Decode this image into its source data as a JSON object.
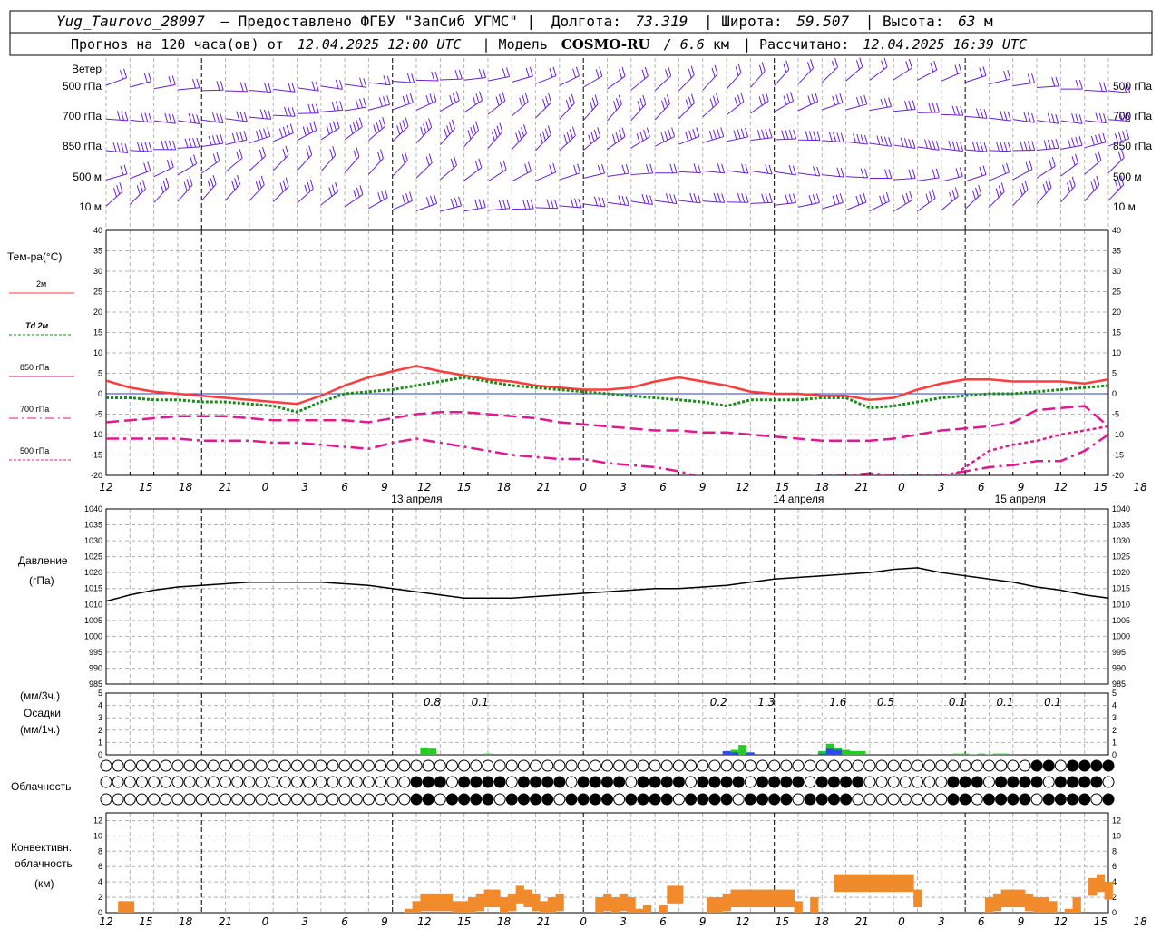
{
  "header": {
    "line1": {
      "station": "Yug_Taurovo_28097",
      "provider": "– Предоставлено ФГБУ \"ЗапСиб УГМС\" |",
      "lon_label": "Долгота:",
      "lon_value": "73.319",
      "lat_label": "| Широта:",
      "lat_value": "59.507",
      "alt_label": "| Высота:",
      "alt_value": "63",
      "alt_unit": "м"
    },
    "line2": {
      "forecast_label": "Прогноз на 120 часа(ов) от",
      "forecast_time": "12.04.2025 12:00 UTC",
      "model_label": "| Модель",
      "model_name": "COSMO-RU",
      "model_res": "/ 6.6",
      "model_res_unit": "км",
      "calc_label": "| Рассчитано:",
      "calc_time": "12.04.2025 16:39 UTC"
    }
  },
  "wind_panel": {
    "title": "Ветер",
    "levels": [
      "500 гПа",
      "700 гПа",
      "850 гПа",
      "500 м",
      "10 м"
    ],
    "color": "#6a1fd6"
  },
  "temp_panel": {
    "title": "Тем-ра(°C)",
    "legend": [
      {
        "label": "2м",
        "color": "#ff3b3b"
      },
      {
        "label": "Td  2м",
        "color": "#1a8a1a"
      },
      {
        "label": "850 гПа",
        "color": "#e0198c"
      },
      {
        "label": "700 гПа",
        "color": "#e0198c"
      },
      {
        "label": "500 гПа",
        "color": "#e0198c"
      }
    ]
  },
  "time_axis": {
    "hour_labels": [
      "12",
      "15",
      "18",
      "21",
      "0",
      "3",
      "6",
      "9",
      "12",
      "15",
      "18",
      "21",
      "0",
      "3",
      "6",
      "9",
      "12",
      "15",
      "18",
      "21",
      "0",
      "3",
      "6",
      "9",
      "12",
      "15",
      "18"
    ],
    "day_labels": [
      "13 апреля",
      "14 апреля",
      "15 апреля"
    ]
  },
  "pressure_panel": {
    "title": "Давление",
    "unit": "(гПа)",
    "ticks": [
      "1040",
      "1035",
      "1030",
      "1025",
      "1020",
      "1015",
      "1010",
      "1005",
      "1000",
      "995",
      "990",
      "985"
    ]
  },
  "precip_panel": {
    "unit3h": "(мм/3ч.)",
    "title": "Осадки",
    "unit1h": "(мм/1ч.)",
    "ticks": [
      "5",
      "4",
      "3",
      "2",
      "1",
      "0"
    ],
    "totals": [
      "0.8",
      "0.1",
      "0.2",
      "1.3",
      "1.6",
      "0.5",
      "0.1",
      "0.1",
      "0.1"
    ]
  },
  "cloud_panel": {
    "title": "Облачность"
  },
  "conv_panel": {
    "title1": "Конвективн.",
    "title2": "облачность",
    "unit": "(км)",
    "ticks": [
      "12",
      "10",
      "8",
      "6",
      "4",
      "2",
      "0"
    ],
    "color": "#f08a2a"
  },
  "temp_ticks": [
    "40",
    "35",
    "30",
    "25",
    "20",
    "15",
    "10",
    "5",
    "0",
    "-5",
    "-10",
    "-15",
    "-20"
  ],
  "chart_data": [
    {
      "type": "line",
      "title": "",
      "ylabel": "Тем-ра(°C)",
      "ylim": [
        -20,
        40
      ],
      "x_hours": [
        0,
        3,
        6,
        9,
        12,
        15,
        18,
        21,
        24,
        27,
        30,
        33,
        36,
        39,
        42,
        45,
        48,
        51,
        54,
        57,
        60,
        63,
        66,
        69,
        72,
        75,
        78,
        81,
        84,
        87,
        90,
        93,
        96,
        99,
        102,
        105,
        108,
        111,
        114,
        117,
        120,
        123,
        126
      ],
      "series": [
        {
          "name": "2м",
          "values": [
            3.2,
            1.5,
            0.5,
            0,
            -0.5,
            -1,
            -1.5,
            -2,
            -2.5,
            -0.5,
            2,
            4,
            5.5,
            6.8,
            5.5,
            4.5,
            3.5,
            3,
            2,
            1.5,
            1,
            1,
            1.5,
            3,
            4,
            3,
            2,
            0.5,
            0,
            0,
            -0.5,
            -0.5,
            -1.5,
            -1,
            1,
            2.5,
            3.5,
            3.5,
            3,
            3,
            3,
            2.5,
            3.5
          ]
        },
        {
          "name": "Td  2м",
          "values": [
            -1,
            -1,
            -1.5,
            -1.5,
            -2,
            -2,
            -2.5,
            -3,
            -4.5,
            -2,
            0,
            0.5,
            1,
            2,
            3,
            4,
            3,
            2,
            1.5,
            1,
            0.5,
            0,
            -0.5,
            -1,
            -1.5,
            -2,
            -3,
            -1.5,
            -1.5,
            -1.5,
            -1,
            -1,
            -3.5,
            -3,
            -2,
            -1,
            -0.5,
            0,
            0,
            0.5,
            1,
            1.5,
            2
          ]
        },
        {
          "name": "850 гПа",
          "values": [
            -7,
            -6.5,
            -6,
            -5.5,
            -5.5,
            -5.5,
            -6,
            -6.5,
            -6.5,
            -6.5,
            -6.5,
            -7,
            -6,
            -5,
            -4.5,
            -4.5,
            -5,
            -5.5,
            -6,
            -7,
            -7.5,
            -8,
            -8.5,
            -9,
            -9,
            -9.5,
            -9.5,
            -10,
            -10.5,
            -11,
            -11.5,
            -11.5,
            -11.5,
            -11,
            -10,
            -9,
            -8.5,
            -8,
            -7,
            -4,
            -3.5,
            -3,
            -8
          ]
        },
        {
          "name": "700 гПа",
          "values": [
            -11,
            -11,
            -11,
            -11,
            -11.5,
            -11.5,
            -11.5,
            -12,
            -12,
            -12.5,
            -13,
            -13.5,
            -12,
            -11,
            -12,
            -13,
            -14,
            -15,
            -15.5,
            -16,
            -16,
            -17,
            -17.5,
            -18,
            -19,
            -20.5,
            -21,
            -21,
            -20.5,
            -20.5,
            -20,
            -20,
            -19.5,
            -20,
            -20,
            -20,
            -19,
            -18,
            -17.5,
            -16.5,
            -16.5,
            -14,
            -10
          ]
        },
        {
          "name": "500 гПа",
          "values": [
            -26,
            -27,
            -27,
            -27,
            -28,
            -28,
            -28.5,
            -28.5,
            -29,
            -29,
            -29.5,
            -29.5,
            -28,
            -27,
            -27,
            -27.5,
            -27,
            -26,
            -27,
            -28,
            -28.5,
            -29,
            -29.5,
            -30,
            -30,
            -30,
            -30,
            -30,
            -29.5,
            -29,
            -29,
            -29,
            -29,
            -28,
            -26,
            -22,
            -18,
            -14,
            -12.5,
            -11.5,
            -10,
            -9,
            -8
          ]
        }
      ]
    },
    {
      "type": "line",
      "title": "",
      "ylabel": "Давление (гПа)",
      "ylim": [
        985,
        1040
      ],
      "x_hours": [
        0,
        3,
        6,
        9,
        12,
        15,
        18,
        21,
        24,
        27,
        30,
        33,
        36,
        39,
        42,
        45,
        48,
        51,
        54,
        57,
        60,
        63,
        66,
        69,
        72,
        75,
        78,
        81,
        84,
        87,
        90,
        93,
        96,
        99,
        102,
        105,
        108,
        111,
        114,
        117,
        120,
        123,
        126
      ],
      "series": [
        {
          "name": "",
          "values": [
            1011,
            1013,
            1014.5,
            1015.5,
            1016,
            1016.5,
            1017,
            1017,
            1017,
            1017,
            1016.5,
            1016,
            1015,
            1014,
            1013,
            1012,
            1012,
            1012,
            1012.5,
            1013,
            1013.5,
            1014,
            1014.5,
            1015,
            1015,
            1015.5,
            1016,
            1017,
            1018,
            1018.5,
            1019,
            1019.5,
            1020,
            1021,
            1021.5,
            1020,
            1019,
            1018,
            1017,
            1015.5,
            1014.5,
            1013,
            1012
          ]
        }
      ]
    },
    {
      "type": "bar",
      "title": "",
      "ylabel": "Осадки (мм/1ч.)",
      "ylim": [
        0,
        5
      ],
      "x_hours": [
        40,
        41,
        42,
        43,
        48,
        78,
        79,
        80,
        81,
        82,
        83,
        84,
        89,
        90,
        91,
        92,
        93,
        94,
        95,
        96,
        107,
        108,
        109,
        110,
        111,
        112,
        113,
        114
      ],
      "series": [
        {
          "name": "green",
          "values": [
            0.6,
            0.5,
            0,
            0,
            0.1,
            0.1,
            0.4,
            0.8,
            0.1,
            0,
            0,
            0,
            0.05,
            0.3,
            0.9,
            0.6,
            0.4,
            0.3,
            0.3,
            0,
            0.1,
            0.1,
            0.05,
            0.1,
            0.05,
            0.1,
            0.1,
            0
          ]
        },
        {
          "name": "blue",
          "values": [
            0,
            0,
            0,
            0,
            0,
            0.3,
            0.2,
            0,
            0.2,
            0,
            0,
            0,
            0,
            0.1,
            0.5,
            0.4,
            0,
            0,
            0,
            0,
            0,
            0,
            0,
            0,
            0,
            0,
            0,
            0
          ]
        }
      ]
    },
    {
      "type": "bar",
      "title": "",
      "ylabel": "Конвективн. облачность (км)",
      "ylim": [
        0,
        13
      ],
      "x_hours": [
        1,
        2,
        3,
        4,
        5,
        6,
        7,
        8,
        9,
        10,
        11,
        12,
        13,
        14,
        15,
        16,
        17,
        18,
        19,
        20,
        21,
        22,
        23,
        24,
        25,
        26,
        27,
        28,
        29,
        30,
        31,
        32,
        33,
        34,
        35,
        36,
        37,
        38,
        39,
        40,
        41,
        42,
        43,
        44,
        45,
        46,
        47,
        48,
        49,
        50,
        51,
        52,
        53,
        54,
        55,
        56,
        57,
        58,
        59,
        60,
        61,
        62,
        63,
        64,
        65,
        66,
        67,
        68,
        69,
        70,
        71,
        72,
        73,
        74,
        75,
        76,
        77,
        78,
        79,
        80,
        81,
        82,
        83,
        84,
        85,
        86,
        87,
        88,
        89,
        90,
        91,
        92,
        93,
        94,
        95,
        96,
        97,
        98,
        99,
        100,
        101,
        102,
        103,
        104,
        105,
        106,
        107,
        108,
        109,
        110,
        111,
        112,
        113,
        114,
        115,
        116,
        117,
        118,
        119,
        120,
        121,
        122,
        123,
        124,
        125,
        126
      ],
      "series": [
        {
          "name": "",
          "values": [
            0,
            1.5,
            1.5,
            0,
            0,
            0,
            0,
            0,
            0,
            0,
            0,
            0,
            0,
            0,
            0,
            0,
            0,
            0,
            0,
            0,
            0,
            0,
            0,
            0,
            0,
            0,
            0,
            0,
            0,
            0,
            0,
            0,
            0,
            0,
            0,
            0,
            0,
            0.5,
            1.5,
            2.5,
            2.5,
            2.5,
            2.5,
            1.5,
            1.5,
            2,
            2.5,
            3,
            3,
            2,
            2.5,
            3.5,
            3,
            2.5,
            1.5,
            2,
            2.5,
            0,
            0,
            0,
            0,
            2,
            2.5,
            2,
            2.5,
            2,
            0.5,
            1,
            0,
            1,
            3.5,
            3.5,
            0,
            0,
            0,
            2,
            2,
            2.5,
            3,
            3,
            3,
            3,
            3,
            3,
            3,
            3,
            1.5,
            0,
            2,
            0,
            0,
            5,
            5,
            5,
            5,
            5,
            5,
            5,
            5,
            5,
            5,
            3,
            0,
            0,
            0,
            0,
            0,
            0,
            0,
            0,
            2,
            2.5,
            3,
            3,
            3,
            2.5,
            2,
            2,
            1.5,
            0,
            0.5,
            2,
            0,
            4.5,
            5,
            4,
            3,
            1.5,
            1.5
          ]
        }
      ]
    }
  ]
}
